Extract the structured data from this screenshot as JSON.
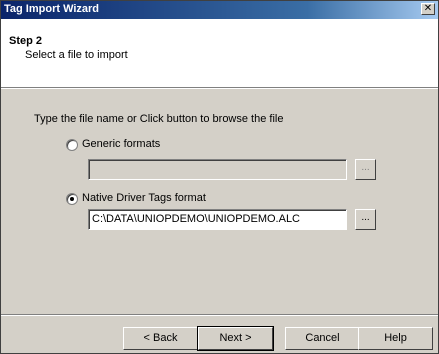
{
  "window": {
    "title": "Tag Import Wizard",
    "close_glyph": "✕"
  },
  "header": {
    "step_title": "Step 2",
    "step_subtitle": "Select a file to import"
  },
  "body": {
    "instruction": "Type the file name or Click button to browse the file",
    "generic": {
      "label": "Generic formats",
      "value": "",
      "selected": false,
      "browse_label": "..."
    },
    "native": {
      "label": "Native Driver Tags format",
      "value": "C:\\DATA\\UNIOPDEMO\\UNIOPDEMO.ALC",
      "selected": true,
      "browse_label": "..."
    }
  },
  "buttons": {
    "back": "< Back",
    "next": "Next >",
    "cancel": "Cancel",
    "help": "Help"
  }
}
